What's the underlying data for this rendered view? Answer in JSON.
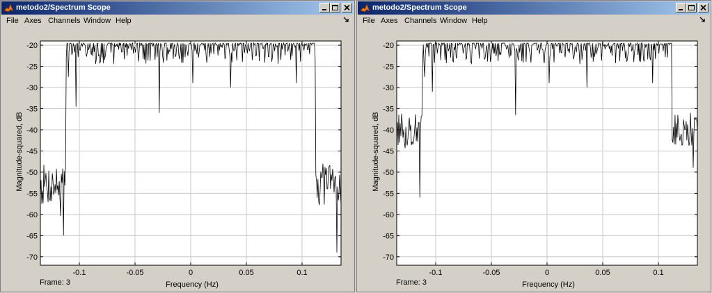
{
  "windows": [
    {
      "title": "metodo2/Spectrum Scope",
      "menu": [
        "File",
        "Axes",
        "Channels",
        "Window",
        "Help"
      ],
      "frame_label": "Frame: 3"
    },
    {
      "title": "metodo2/Spectrum Scope",
      "menu": [
        "File",
        "Axes",
        "Channels",
        "Window",
        "Help"
      ],
      "frame_label": "Frame: 3"
    }
  ],
  "colors": {
    "titlebar_start": "#0a246a",
    "titlebar_end": "#a6caf0",
    "trace": "#000000",
    "grid": "#c8c8c8",
    "window_bg": "#d4d0c8"
  },
  "icons": [
    "matlab-icon",
    "minimize-icon",
    "maximize-icon",
    "close-icon",
    "dock-icon"
  ],
  "chart_data": [
    {
      "type": "line",
      "xlabel": "Frequency (Hz)",
      "ylabel": "Magnitude-squared, dB",
      "xlim": [
        -0.135,
        0.135
      ],
      "ylim": [
        -72,
        -19
      ],
      "xticks": [
        -0.1,
        -0.05,
        0,
        0.05,
        0.1
      ],
      "xtick_labels": [
        "-0.1",
        "-0.05",
        "0",
        "0.05",
        "0.1"
      ],
      "yticks": [
        -20,
        -25,
        -30,
        -35,
        -40,
        -45,
        -50,
        -55,
        -60,
        -65,
        -70
      ],
      "ytick_labels": [
        "-20",
        "-25",
        "-30",
        "-35",
        "-40",
        "-45",
        "-50",
        "-55",
        "-60",
        "-65",
        "-70"
      ],
      "grid": true,
      "passband": [
        -0.112,
        0.112
      ],
      "passband_level_db": -19.5,
      "passband_spikes": [
        {
          "x": -0.103,
          "y": -34.5
        },
        {
          "x": -0.11,
          "y": -27.5
        },
        {
          "x": -0.028,
          "y": -36
        },
        {
          "x": 0.036,
          "y": -30
        },
        {
          "x": 0.095,
          "y": -29
        },
        {
          "x": 0.002,
          "y": -29
        }
      ],
      "stopband_level_db": -53,
      "stopband_spread_db": 5,
      "stopband_min_db": [
        -65,
        -69
      ]
    },
    {
      "type": "line",
      "xlabel": "Frequency (Hz)",
      "ylabel": "Magnitude-squared, dB",
      "xlim": [
        -0.135,
        0.135
      ],
      "ylim": [
        -72,
        -19
      ],
      "xticks": [
        -0.1,
        -0.05,
        0,
        0.05,
        0.1
      ],
      "xtick_labels": [
        "-0.1",
        "-0.05",
        "0",
        "0.05",
        "0.1"
      ],
      "yticks": [
        -20,
        -25,
        -30,
        -35,
        -40,
        -45,
        -50,
        -55,
        -60,
        -65,
        -70
      ],
      "ytick_labels": [
        "-20",
        "-25",
        "-30",
        "-35",
        "-40",
        "-45",
        "-50",
        "-55",
        "-60",
        "-65",
        "-70"
      ],
      "grid": true,
      "passband": [
        -0.112,
        0.112
      ],
      "passband_level_db": -19.5,
      "passband_spikes": [
        {
          "x": -0.103,
          "y": -31
        },
        {
          "x": -0.11,
          "y": -27.5
        },
        {
          "x": -0.028,
          "y": -36.5
        },
        {
          "x": 0.036,
          "y": -30
        },
        {
          "x": 0.095,
          "y": -29
        },
        {
          "x": 0.002,
          "y": -29
        }
      ],
      "stopband_level_db": -40,
      "stopband_spread_db": 4,
      "stopband_min_db": [
        -56,
        -49
      ]
    }
  ]
}
